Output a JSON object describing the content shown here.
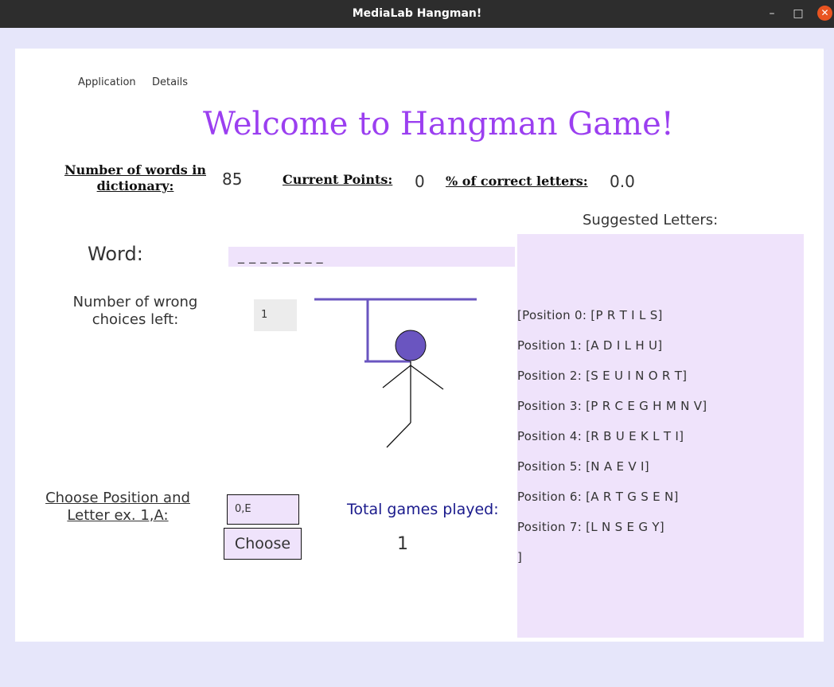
{
  "window": {
    "title": "MediaLab Hangman!",
    "minimize_glyph": "–",
    "maximize_glyph": "□",
    "close_glyph": "✕"
  },
  "menu": {
    "items": [
      "Application",
      "Details"
    ]
  },
  "heading": "Welcome to Hangman Game!",
  "stats": {
    "words_label_line1": "Number of words in",
    "words_label_line2": "dictionary:",
    "words_value": "85",
    "points_label": "Current Points:",
    "points_value": "0",
    "correct_label": "% of correct letters:",
    "correct_value": "0.0"
  },
  "word": {
    "label": "Word:",
    "value": "_ _ _ _ _ _ _ _"
  },
  "wrong_choices": {
    "label_line1": "Number of wrong",
    "label_line2": "choices left:",
    "value": "1"
  },
  "choose": {
    "label_line1": "Choose Position and",
    "label_line2": "Letter ex. 1,A:",
    "input_value": "0,E",
    "button_label": "Choose"
  },
  "games": {
    "label": "Total games played:",
    "value": "1"
  },
  "suggested": {
    "label": "Suggested Letters:",
    "lines": [
      "[Position 0: [P R T I L S]",
      " Position 1: [A D I L H U]",
      " Position 2: [S E U I N O R T]",
      " Position 3: [P R C E G H M N V]",
      " Position 4: [R B U E K L T I]",
      " Position 5: [N A E V I]",
      " Position 6: [A R T G S E N]",
      " Position 7: [L N S E G Y]",
      "]"
    ]
  },
  "colors": {
    "heading": "#9b3ff0",
    "gallows": "#6a55c0",
    "panel": "#efe3fb",
    "games_label": "#1a1a8c"
  }
}
